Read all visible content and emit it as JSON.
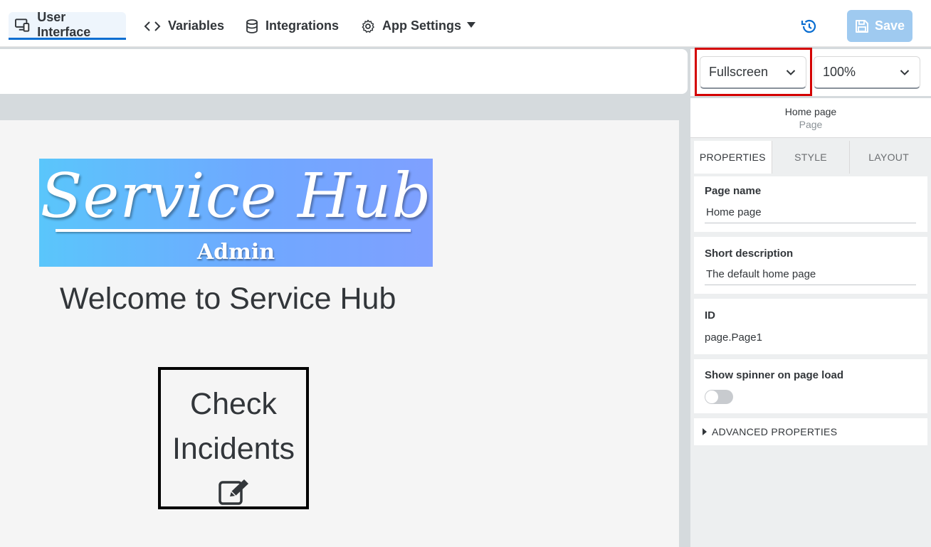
{
  "nav": {
    "tabs": [
      {
        "label": "User Interface",
        "icon": "monitor-phone-icon",
        "active": true
      },
      {
        "label": "Variables",
        "icon": "code-brackets-icon"
      },
      {
        "label": "Integrations",
        "icon": "database-icon"
      },
      {
        "label": "App Settings",
        "icon": "gear-icon"
      }
    ],
    "save_label": "Save"
  },
  "toolbar": {
    "device_select": "Fullscreen",
    "zoom_select": "100%"
  },
  "canvas": {
    "banner_title": "Service Hub",
    "banner_subtitle": "Admin",
    "welcome_text": "Welcome to Service Hub",
    "card_line1": "Check",
    "card_line2": "Incidents"
  },
  "panel": {
    "title": "Home page",
    "subtitle": "Page",
    "tabs": [
      "PROPERTIES",
      "STYLE",
      "LAYOUT"
    ],
    "page_name_label": "Page name",
    "page_name_value": "Home page",
    "short_desc_label": "Short description",
    "short_desc_value": "The default home page",
    "id_label": "ID",
    "id_value": "page.Page1",
    "spinner_label": "Show spinner on page load",
    "advanced_label": "ADVANCED PROPERTIES"
  },
  "colors": {
    "accent": "#0a6ed1",
    "save_bg": "#9fcaf0",
    "highlight": "#d40000"
  }
}
